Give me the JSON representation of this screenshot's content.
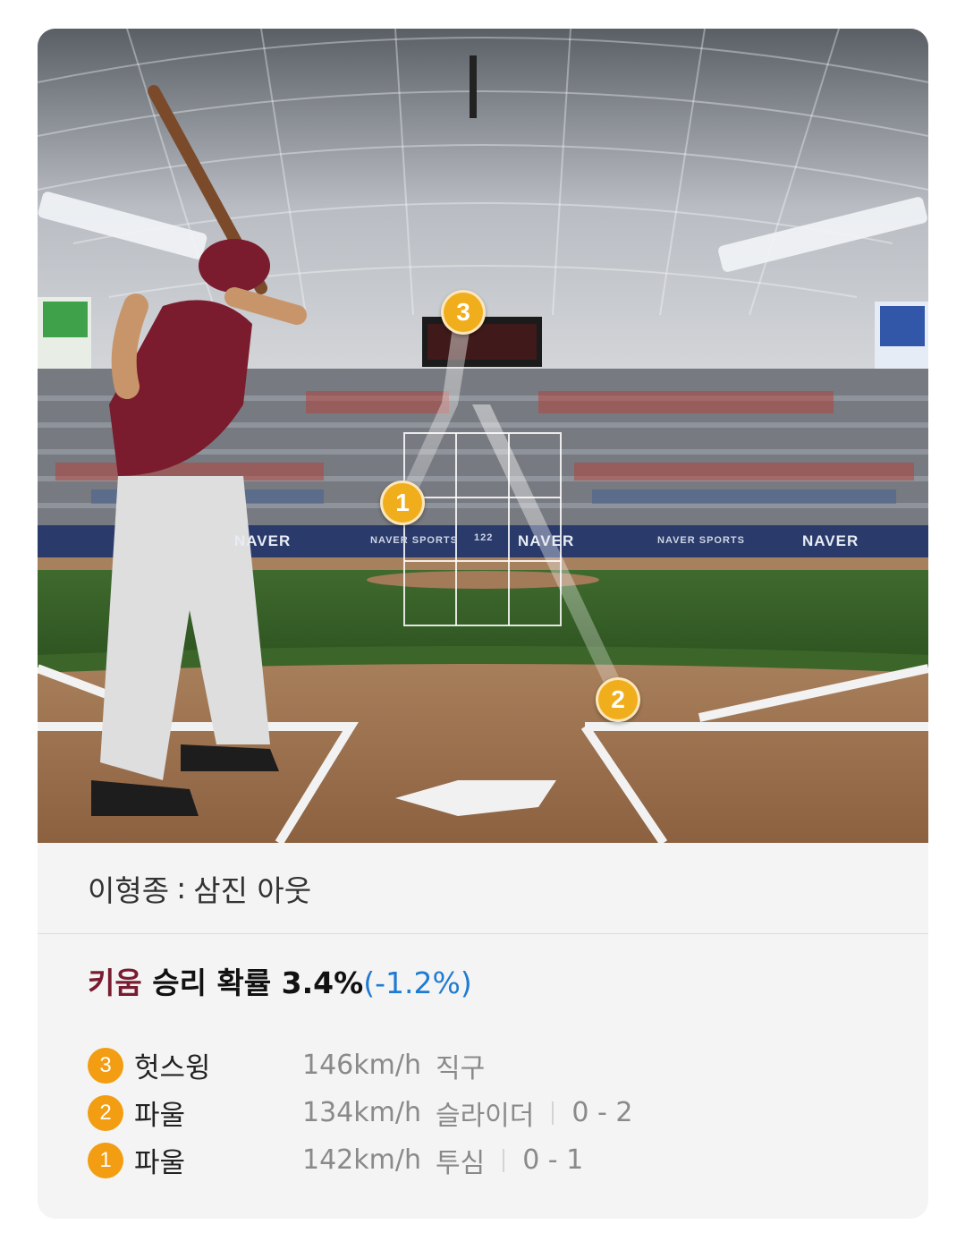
{
  "result": {
    "batter": "이형종",
    "separator": ":",
    "outcome": "삼진 아웃"
  },
  "win_probability": {
    "team": "키움",
    "label": "승리 확률",
    "value": "3.4%",
    "delta": "(-1.2%)",
    "team_color": "#7a1c30",
    "delta_color": "#1e7bd3"
  },
  "pitches": [
    {
      "number": "3",
      "result": "헛스윙",
      "speed": "146km/h",
      "type": "직구",
      "count": ""
    },
    {
      "number": "2",
      "result": "파울",
      "speed": "134km/h",
      "type": "슬라이더",
      "count": "0 - 2"
    },
    {
      "number": "1",
      "result": "파울",
      "speed": "142km/h",
      "type": "투심",
      "count": "0 - 1"
    }
  ],
  "stadium": {
    "board_brand_1": "NAVER",
    "board_brand_2": "NAVER SPORTS",
    "board_brand_3": "NAVER",
    "board_brand_4": "NAVER SPORTS",
    "board_brand_5": "NAVER",
    "board_speed": "122",
    "marker_color": "#f1ae1c"
  }
}
